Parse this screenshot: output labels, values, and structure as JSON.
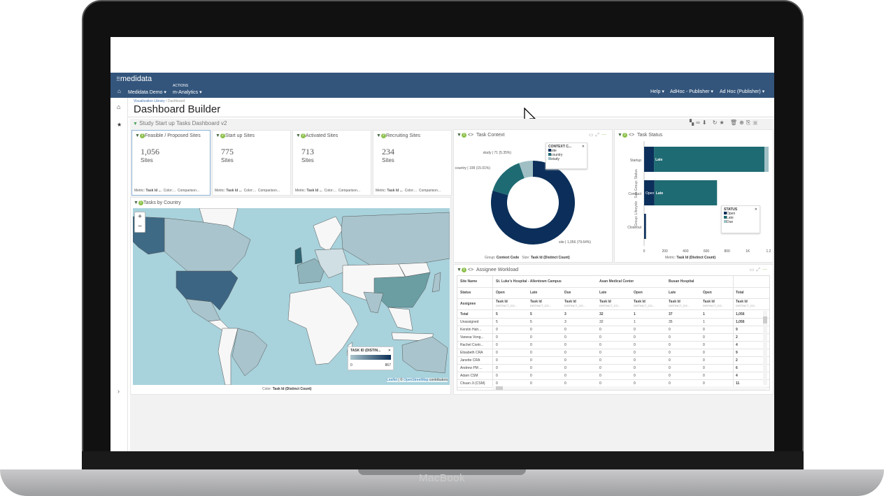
{
  "device": {
    "brand": "MacBook"
  },
  "header": {
    "logo": "medidata",
    "actions_label": "ACTIONS",
    "nav": [
      "Medidata Demo",
      "m-Analytics"
    ],
    "right_menu": [
      "Help",
      "AdHoc - Publisher",
      "Ad Hoc (Publisher)"
    ],
    "color": "#33557c"
  },
  "breadcrumb": {
    "root": "Visualization Library",
    "current": "Dashboard"
  },
  "page_title": "Dashboard Builder",
  "dashboard_name": "Study Start up Tasks Dashboard v2",
  "kpis": [
    {
      "title": "Feasible / Proposed Sites",
      "badge": "1",
      "value": "1,056",
      "unit": "Sites",
      "footer_metric": "Metric:",
      "footer_metric_val": "Task Id ...",
      "footer_color": "Color:...",
      "footer_comp": "Comparison..."
    },
    {
      "title": "Start up Sites",
      "badge": "2",
      "value": "775",
      "unit": "Sites",
      "footer_metric": "Metric:",
      "footer_metric_val": "Task Id ...",
      "footer_color": "Color:...",
      "footer_comp": "Comparison..."
    },
    {
      "title": "Activated Sites",
      "badge": "2",
      "value": "713",
      "unit": "Sites",
      "footer_metric": "Metric:",
      "footer_metric_val": "Task Id ...",
      "footer_color": "Color:...",
      "footer_comp": "Comparison..."
    },
    {
      "title": "Recruiting Sites",
      "badge": "2",
      "value": "234",
      "unit": "Sites",
      "footer_metric": "Metric:",
      "footer_metric_val": "Task Id ...",
      "footer_color": "Color:...",
      "footer_comp": "Comparison..."
    }
  ],
  "map": {
    "title": "Tasks by Country",
    "badge": "1",
    "zoom_in": "+",
    "zoom_out": "−",
    "legend_title": "TASK ID (DISTIN...",
    "legend_min": "0",
    "legend_max": "867",
    "attribution_leaflet": "Leaflet",
    "attribution_sep": " | © ",
    "attribution_osm": "OpenStreetMap",
    "attribution_tail": " contributors",
    "footer_label": "Color:",
    "footer_value": "Task Id (Distinct Count)",
    "colors": {
      "low": "#a9c4cc",
      "high": "#0c2f57",
      "water": "#a8d2dc"
    }
  },
  "task_context": {
    "title": "Task Context",
    "badge": "1",
    "legend_title": "CONTEXT C...",
    "footer_group_label": "Group:",
    "footer_group": "Context Code",
    "footer_size_label": "Size:",
    "footer_size": "Task Id (Distinct Count)",
    "chart_data": {
      "type": "pie",
      "donut": true,
      "slices": [
        {
          "label": "site",
          "value": 1056,
          "pct": "79.64%",
          "text": "site | 1,056 (79.64%)",
          "color": "#0b2f5a"
        },
        {
          "label": "country",
          "value": 199,
          "pct": "15.01%",
          "text": "country | 199 (15.01%)",
          "color": "#1f6b73"
        },
        {
          "label": "study",
          "value": 71,
          "pct": "5.35%",
          "text": "study | 71 (5.35%)",
          "color": "#9fbfc5"
        }
      ]
    }
  },
  "task_status": {
    "title": "Task Status",
    "badge": "2",
    "legend_title": "STATUS",
    "yaxis_group": "Group: Lifecycle",
    "yaxis_sub": "Sub-Group: Status",
    "footer_label": "Metric:",
    "footer_value": "Task Id (Distinct Count)",
    "chart_data": {
      "type": "bar",
      "orientation": "horizontal",
      "stacked": true,
      "categories": [
        "Startup",
        "Conduct",
        "Closeout"
      ],
      "xlim": [
        0,
        1200
      ],
      "xticks": [
        "0",
        "200",
        "400",
        "600",
        "800",
        "1K",
        "1.2"
      ],
      "series": [
        {
          "name": "Open",
          "color": "#0b2f5a",
          "values": [
            95,
            100,
            18
          ]
        },
        {
          "name": "Late",
          "color": "#1f6b73",
          "values": [
            1065,
            603,
            0
          ]
        },
        {
          "name": "Due",
          "color": "#9fbfc5",
          "values": [
            40,
            0,
            0
          ]
        }
      ],
      "bar_labels": [
        [
          "",
          "Late"
        ],
        [
          "Open",
          "Late"
        ],
        [
          "",
          ""
        ]
      ]
    }
  },
  "workload": {
    "title": "Assignee Workload",
    "badge": "1",
    "row_headers": [
      "Site Name",
      "Status",
      "Assignee"
    ],
    "sites": [
      "St. Luke's Hospital - Allentown Campus",
      "Asan Medical Center",
      "Busan Hospital"
    ],
    "statuses": [
      "Open",
      "Late",
      "Due",
      "Late",
      "Open",
      "Late",
      "Open",
      "Total"
    ],
    "measure": "Task Id",
    "measure_sub": "DISTINCT_CO...",
    "rows": [
      {
        "name": "Total",
        "vals": [
          "5",
          "5",
          "3",
          "32",
          "1",
          "37",
          "1",
          "1,056"
        ]
      },
      {
        "name": "Unassigned",
        "vals": [
          "5",
          "5",
          "3",
          "32",
          "1",
          "35",
          "1",
          "1,056"
        ]
      },
      {
        "name": "Kerstin Hah...",
        "vals": [
          "0",
          "0",
          "0",
          "0",
          "0",
          "0",
          "0",
          "9"
        ]
      },
      {
        "name": "Vanesa Vong...",
        "vals": [
          "0",
          "0",
          "0",
          "0",
          "0",
          "0",
          "0",
          "2"
        ]
      },
      {
        "name": "Rachel Contr...",
        "vals": [
          "0",
          "0",
          "0",
          "0",
          "0",
          "0",
          "0",
          "4"
        ]
      },
      {
        "name": "Elisabeth CRA",
        "vals": [
          "0",
          "0",
          "0",
          "0",
          "0",
          "0",
          "0",
          "9"
        ]
      },
      {
        "name": "Janette CRA",
        "vals": [
          "0",
          "0",
          "0",
          "0",
          "0",
          "0",
          "0",
          "2"
        ]
      },
      {
        "name": "Andrew PM ...",
        "vals": [
          "0",
          "0",
          "0",
          "0",
          "0",
          "0",
          "0",
          "6"
        ]
      },
      {
        "name": "Adam CSM",
        "vals": [
          "0",
          "0",
          "0",
          "0",
          "0",
          "0",
          "0",
          "4"
        ]
      },
      {
        "name": "Chuan Ji (CSM)",
        "vals": [
          "0",
          "0",
          "0",
          "0",
          "0",
          "0",
          "0",
          "11"
        ]
      }
    ]
  }
}
